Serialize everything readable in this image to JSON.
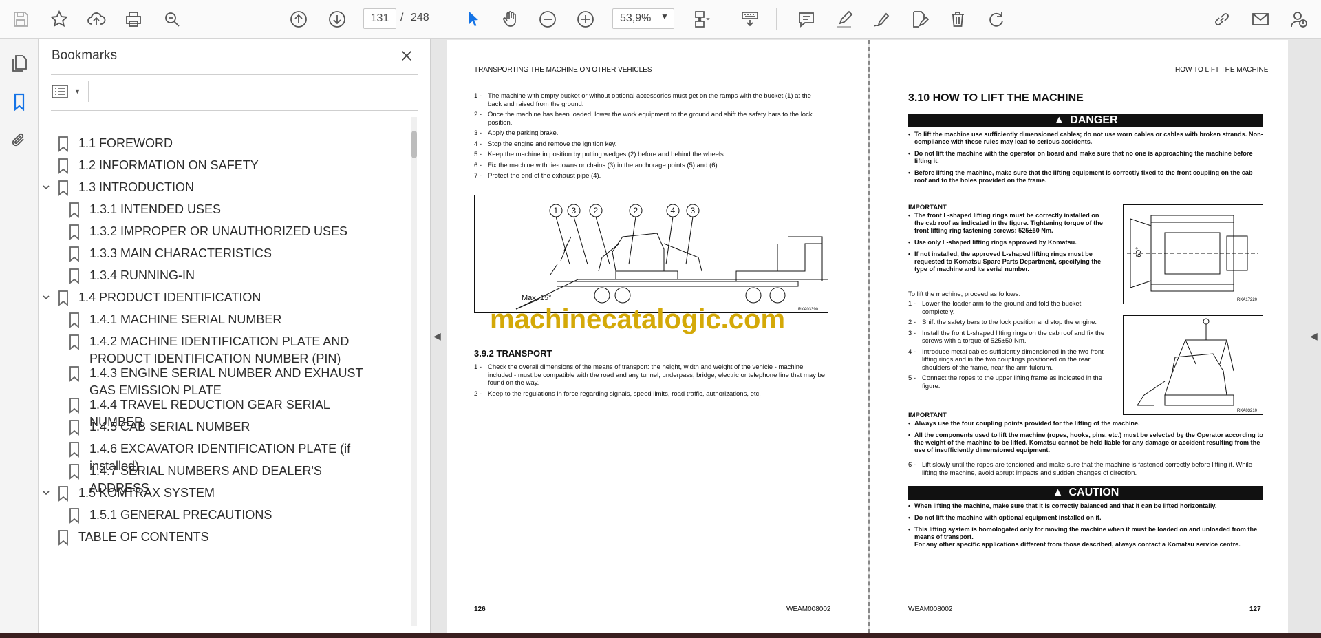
{
  "toolbar": {
    "page_current": "131",
    "page_separator": "/",
    "page_total": "248",
    "zoom": "53,9%"
  },
  "bookmarks": {
    "title": "Bookmarks",
    "items": [
      {
        "label": "1.1 FOREWORD",
        "level": 0,
        "expander": false
      },
      {
        "label": "1.2 INFORMATION ON SAFETY",
        "level": 0,
        "expander": false
      },
      {
        "label": "1.3 INTRODUCTION",
        "level": 0,
        "expander": true
      },
      {
        "label": "1.3.1 INTENDED USES",
        "level": 1,
        "expander": false
      },
      {
        "label": "1.3.2 IMPROPER OR UNAUTHORIZED USES",
        "level": 1,
        "expander": false
      },
      {
        "label": "1.3.3 MAIN CHARACTERISTICS",
        "level": 1,
        "expander": false
      },
      {
        "label": "1.3.4 RUNNING-IN",
        "level": 1,
        "expander": false
      },
      {
        "label": "1.4 PRODUCT IDENTIFICATION",
        "level": 0,
        "expander": true
      },
      {
        "label": "1.4.1 MACHINE SERIAL NUMBER",
        "level": 1,
        "expander": false
      },
      {
        "label": "1.4.2 MACHINE IDENTIFICATION PLATE AND PRODUCT IDENTIFICATION NUMBER (PIN)",
        "level": 1,
        "expander": false
      },
      {
        "label": "1.4.3 ENGINE SERIAL NUMBER AND EXHAUST GAS EMISSION PLATE",
        "level": 1,
        "expander": false
      },
      {
        "label": "1.4.4 TRAVEL REDUCTION GEAR SERIAL NUMBER",
        "level": 1,
        "expander": false
      },
      {
        "label": "1.4.5 CAB SERIAL NUMBER",
        "level": 1,
        "expander": false
      },
      {
        "label": "1.4.6 EXCAVATOR IDENTIFICATION PLATE (if installed)",
        "level": 1,
        "expander": false
      },
      {
        "label": "1.4.7 SERIAL NUMBERS AND DEALER'S ADDRESS",
        "level": 1,
        "expander": false
      },
      {
        "label": "1.5 KOMTRAX SYSTEM",
        "level": 0,
        "expander": true
      },
      {
        "label": "1.5.1 GENERAL PRECAUTIONS",
        "level": 1,
        "expander": false
      },
      {
        "label": "TABLE OF CONTENTS",
        "level": 0,
        "expander": false
      }
    ]
  },
  "left_page": {
    "header": "TRANSPORTING THE MACHINE ON OTHER VEHICLES",
    "steps": [
      {
        "n": "1 -",
        "t": "The machine with empty bucket or without optional accessories must get on the ramps with the bucket (1) at the back and raised from the ground."
      },
      {
        "n": "2 -",
        "t": "Once the machine has been loaded, lower the work equipment to the ground and shift the safety bars to the lock position."
      },
      {
        "n": "3 -",
        "t": "Apply the parking brake."
      },
      {
        "n": "4 -",
        "t": "Stop the engine and remove the ignition key."
      },
      {
        "n": "5 -",
        "t": "Keep the machine in position by putting wedges (2) before and behind the wheels."
      },
      {
        "n": "6 -",
        "t": "Fix the machine with tie-downs or chains (3) in the anchorage points (5) and (6)."
      },
      {
        "n": "7 -",
        "t": "Protect the end of the exhaust pipe (4)."
      }
    ],
    "figure": {
      "callouts": [
        "1",
        "3",
        "2",
        "2",
        "4",
        "3"
      ],
      "angle_label": "Max. 15°",
      "code": "RKA03390"
    },
    "section": "3.9.2   TRANSPORT",
    "transport_steps": [
      {
        "n": "1 -",
        "t": "Check the overall dimensions of the means of transport: the height, width and weight of the vehicle - machine included - must be compatible with the road and any tunnel, underpass, bridge, electric or telephone line that may be found on the way."
      },
      {
        "n": "2 -",
        "t": "Keep to the regulations in force regarding signals, speed limits, road traffic, authorizations, etc."
      }
    ],
    "footer_left": "126",
    "footer_right": "WEAM008002"
  },
  "right_page": {
    "header": "HOW TO LIFT THE MACHINE",
    "title": "3.10  HOW TO LIFT THE MACHINE",
    "danger_label": "DANGER",
    "danger_items": [
      "To lift the machine use sufficiently dimensioned cables; do not use worn cables or cables with broken strands. Non-compliance with these rules may lead to serious accidents.",
      "Do not lift the machine with the operator on board and make sure that no one is approaching the machine before lifting it.",
      "Before lifting the machine, make sure that the lifting equipment is correctly fixed to the front coupling on the cab roof and to the holes provided on the frame."
    ],
    "important_label": "IMPORTANT",
    "important_items": [
      "The front L-shaped lifting rings must be correctly installed on the cab roof as indicated in the figure. Tightening torque of the front lifting ring fastening screws: 525±50 Nm.",
      "Use only L-shaped lifting rings approved by Komatsu.",
      "If not installed, the approved L-shaped lifting rings must be requested to Komatsu Spare Parts Department, specifying the type of machine and its serial number."
    ],
    "proceed": "To lift the machine, proceed as follows:",
    "lift_steps": [
      {
        "n": "1 -",
        "t": "Lower the loader arm to the ground and fold the bucket completely."
      },
      {
        "n": "2 -",
        "t": "Shift the safety bars to the lock position and stop the engine."
      },
      {
        "n": "3 -",
        "t": "Install the front L-shaped lifting rings on the cab roof and fix the screws with a torque of 525±50 Nm."
      },
      {
        "n": "4 -",
        "t": "Introduce metal cables sufficiently dimensioned in the two front lifting rings and in the two couplings positioned on the rear shoulders of the frame, near the arm fulcrum."
      },
      {
        "n": "5 -",
        "t": "Connect the ropes to the upper lifting frame as indicated in the figure."
      }
    ],
    "fig1_code": "RKA17220",
    "fig1_label": "60°",
    "fig2_code": "RKA03210",
    "important2_label": "IMPORTANT",
    "important2_items": [
      "Always use the four coupling points provided for the lifting of the machine.",
      "All the components used to lift the machine (ropes, hooks, pins, etc.) must be selected by the Operator according to the weight of the machine to be lifted. Komatsu cannot be held liable for any damage or accident resulting from the use of insufficiently dimensioned equipment."
    ],
    "step6": {
      "n": "6 -",
      "t": "Lift slowly until the ropes are tensioned and make sure that the machine is fastened correctly before lifting it. While lifting the machine, avoid abrupt impacts and sudden changes of direction."
    },
    "caution_label": "CAUTION",
    "caution_items": [
      "When lifting the machine, make sure that it is correctly balanced and that it can be lifted horizontally.",
      "Do not lift the machine with optional equipment installed on it.",
      "This lifting system is homologated only for moving the machine when it must be loaded on and unloaded from the means of transport.\nFor any other specific applications different from those described, always contact a Komatsu service centre."
    ],
    "footer_left": "WEAM008002",
    "footer_right": "127"
  },
  "watermark": "machinecatalogic.com",
  "colors": {
    "accent": "#1473e6",
    "watermark": "#d4a908"
  }
}
